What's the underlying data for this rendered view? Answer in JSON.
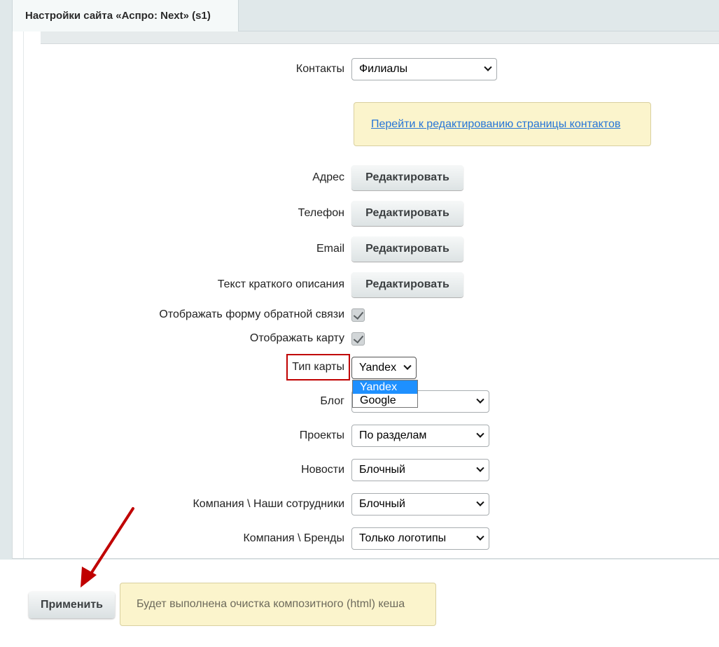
{
  "window": {
    "tab_title": "Настройки сайта «Аспро: Next» (s1)"
  },
  "form": {
    "contacts": {
      "label": "Контакты",
      "value": "Филиалы"
    },
    "contacts_notice": {
      "link_text": "Перейти к редактированию страницы контактов"
    },
    "address": {
      "label": "Адрес",
      "button": "Редактировать"
    },
    "phone": {
      "label": "Телефон",
      "button": "Редактировать"
    },
    "email": {
      "label": "Email",
      "button": "Редактировать"
    },
    "short_text": {
      "label": "Текст краткого описания",
      "button": "Редактировать"
    },
    "feedback_form": {
      "label": "Отображать форму обратной связи",
      "checked": true
    },
    "show_map": {
      "label": "Отображать карту",
      "checked": true
    },
    "map_type": {
      "label": "Тип карты",
      "value": "Yandex",
      "options": [
        "Yandex",
        "Google"
      ],
      "highlighted_option": "Yandex"
    },
    "blog": {
      "label": "Блог",
      "value": ""
    },
    "projects": {
      "label": "Проекты",
      "value": "По разделам"
    },
    "news": {
      "label": "Новости",
      "value": "Блочный"
    },
    "company_staff": {
      "label": "Компания \\ Наши сотрудники",
      "value": "Блочный"
    },
    "company_brands": {
      "label": "Компания \\ Бренды",
      "value": "Только логотипы"
    }
  },
  "footer": {
    "apply_button": "Применить",
    "notice": "Будет выполнена очистка композитного (html) кеша"
  },
  "colors": {
    "annotation_red": "#c00000",
    "link_blue": "#2675d7",
    "notice_bg": "#fbf4cc",
    "selected_option_bg": "#1e90ff"
  }
}
